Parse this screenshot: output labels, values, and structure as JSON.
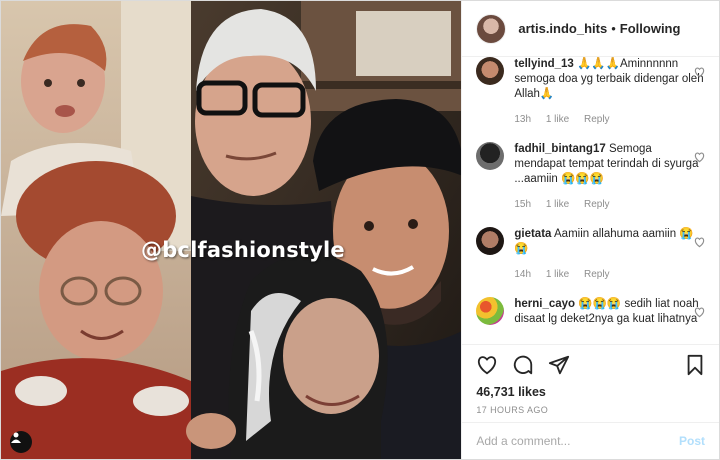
{
  "post": {
    "watermark": "@bclfashionstyle"
  },
  "header": {
    "username": "artis.indo_hits",
    "separator": "•",
    "follow_status": "Following"
  },
  "comments": [
    {
      "user": "tellyind_13",
      "text": "🙏🙏🙏Aminnnnnn semoga doa yg terbaik didengar oleh Allah🙏",
      "time": "13h",
      "likes": "1 like",
      "reply": "Reply"
    },
    {
      "user": "fadhil_bintang17",
      "text": "Semoga mendapat tempat terindah di syurga ...aamiin 😭😭😭",
      "time": "15h",
      "likes": "1 like",
      "reply": "Reply"
    },
    {
      "user": "gietata",
      "text": "Aamiin allahuma aamiin 😭😭",
      "time": "14h",
      "likes": "1 like",
      "reply": "Reply"
    },
    {
      "user": "herni_cayo",
      "text": "😭😭😭 sedih liat noah disaat lg deket2nya ga kuat lihatnya",
      "time": "",
      "likes": "",
      "reply": ""
    }
  ],
  "engagement": {
    "likes": "46,731 likes",
    "time": "17 HOURS AGO"
  },
  "composer": {
    "placeholder": "Add a comment...",
    "post_label": "Post"
  },
  "icons": {
    "like": "heart-icon",
    "comment": "comment-icon",
    "share": "share-icon",
    "save": "bookmark-icon",
    "tag": "user-tag-icon"
  },
  "colors": {
    "link": "#0095f6",
    "post_disabled": "#b2dffc",
    "muted": "#8e8e8e"
  }
}
